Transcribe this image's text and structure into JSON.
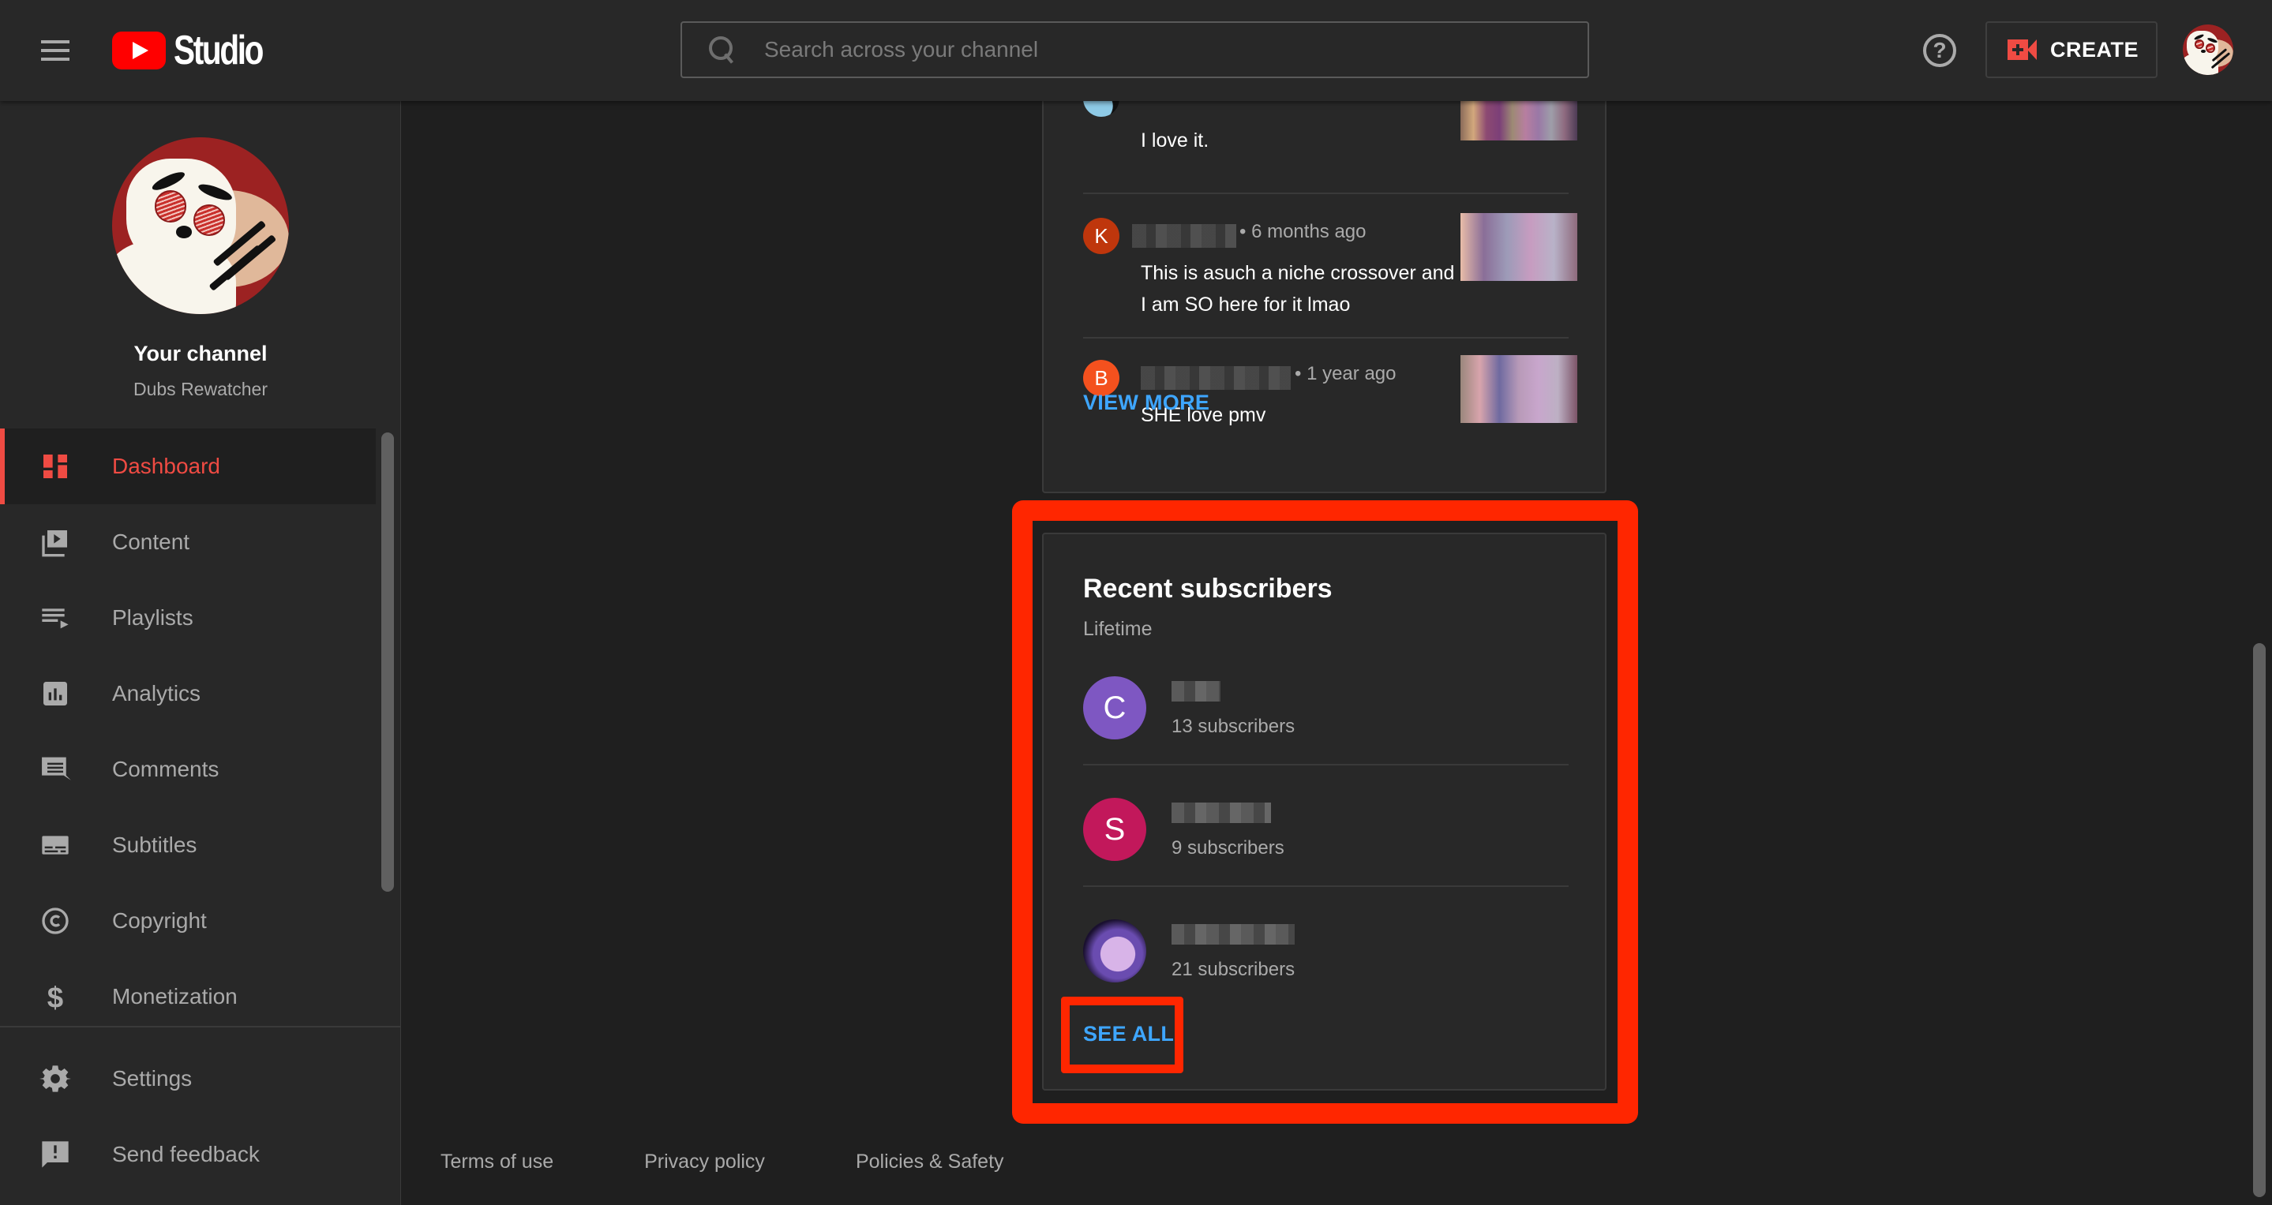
{
  "header": {
    "logo_text": "Studio",
    "search_placeholder": "Search across your channel",
    "help_symbol": "?",
    "create_label": "CREATE"
  },
  "sidebar": {
    "channel_title": "Your channel",
    "channel_name": "Dubs Rewatcher",
    "items": [
      {
        "label": "Dashboard",
        "icon": "dashboard-icon",
        "active": true
      },
      {
        "label": "Content",
        "icon": "content-icon"
      },
      {
        "label": "Playlists",
        "icon": "playlists-icon"
      },
      {
        "label": "Analytics",
        "icon": "analytics-icon"
      },
      {
        "label": "Comments",
        "icon": "comments-icon"
      },
      {
        "label": "Subtitles",
        "icon": "subtitles-icon"
      },
      {
        "label": "Copyright",
        "icon": "copyright-icon"
      },
      {
        "label": "Monetization",
        "icon": "monetization-icon"
      }
    ],
    "bottom_items": [
      {
        "label": "Settings",
        "icon": "settings-icon"
      },
      {
        "label": "Send feedback",
        "icon": "feedback-icon"
      }
    ]
  },
  "comments": {
    "items": [
      {
        "avatar_letter": "",
        "author": "[blurred]",
        "time": "",
        "text": "I love it."
      },
      {
        "avatar_letter": "K",
        "avatar_color": "#bf360c",
        "author": "[blurred]",
        "time": "• 6 months ago",
        "text": "This is asuch a niche crossover and I am SO here for it lmao"
      },
      {
        "avatar_letter": "B",
        "avatar_color": "#f4511e",
        "author": "[blurred]",
        "time": "• 1 year ago",
        "text": "SHE love pmv"
      }
    ],
    "view_more_label": "VIEW MORE"
  },
  "recent_subscribers": {
    "title": "Recent subscribers",
    "period": "Lifetime",
    "items": [
      {
        "avatar_letter": "C",
        "avatar_color": "#7e57c2",
        "name": "[blurred]",
        "subscribers": "13 subscribers"
      },
      {
        "avatar_letter": "S",
        "avatar_color": "#c2185b",
        "name": "[blurred]",
        "subscribers": "9 subscribers"
      },
      {
        "avatar_letter": "",
        "name": "[blurred]",
        "subscribers": "21 subscribers"
      }
    ],
    "see_all_label": "SEE ALL"
  },
  "footer": {
    "links": [
      "Terms of use",
      "Privacy policy",
      "Policies & Safety"
    ]
  },
  "colors": {
    "accent_red": "#ef4b43",
    "link_blue": "#3ea6ff",
    "annotation_red": "#ff2600"
  }
}
